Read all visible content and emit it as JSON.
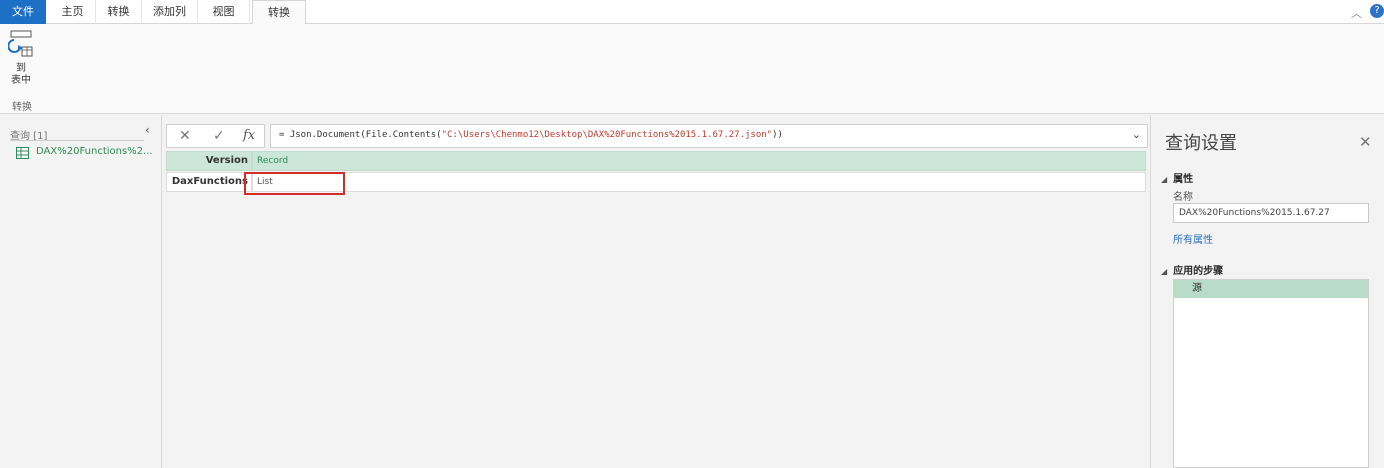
{
  "tabs": [
    {
      "label": "文件",
      "kind": "file"
    },
    {
      "label": "主页"
    },
    {
      "label": "转换"
    },
    {
      "label": "添加列"
    },
    {
      "label": "视图"
    },
    {
      "label": "转换",
      "active": true
    }
  ],
  "help_label": "?",
  "ribbon": {
    "to_table_label_line1": "到",
    "to_table_label_line2": "表中",
    "group_label": "转换"
  },
  "queries_pane": {
    "title": "查询 [1]",
    "item_label": "DAX%20Functions%2..."
  },
  "formula_bar": {
    "prefix": "= Json.Document(File.Contents(",
    "string": "\"C:\\Users\\Chenmo12\\Desktop\\DAX%20Functions%2015.1.67.27.json\"",
    "suffix": "))"
  },
  "grid": {
    "header_key": "Version",
    "header_value": "Record",
    "row_key": "DaxFunctions",
    "row_value": "List"
  },
  "query_settings": {
    "title": "查询设置",
    "properties_label": "属性",
    "name_label": "名称",
    "name_value": "DAX%20Functions%2015.1.67.27",
    "all_properties_link": "所有属性",
    "applied_steps_label": "应用的步骤",
    "steps": [
      "源"
    ]
  },
  "colors": {
    "file_tab": "#1e6fc6",
    "grid_header": "#cde6da",
    "selected_step": "#b9dcc8",
    "highlight_box": "#d62b2b"
  }
}
